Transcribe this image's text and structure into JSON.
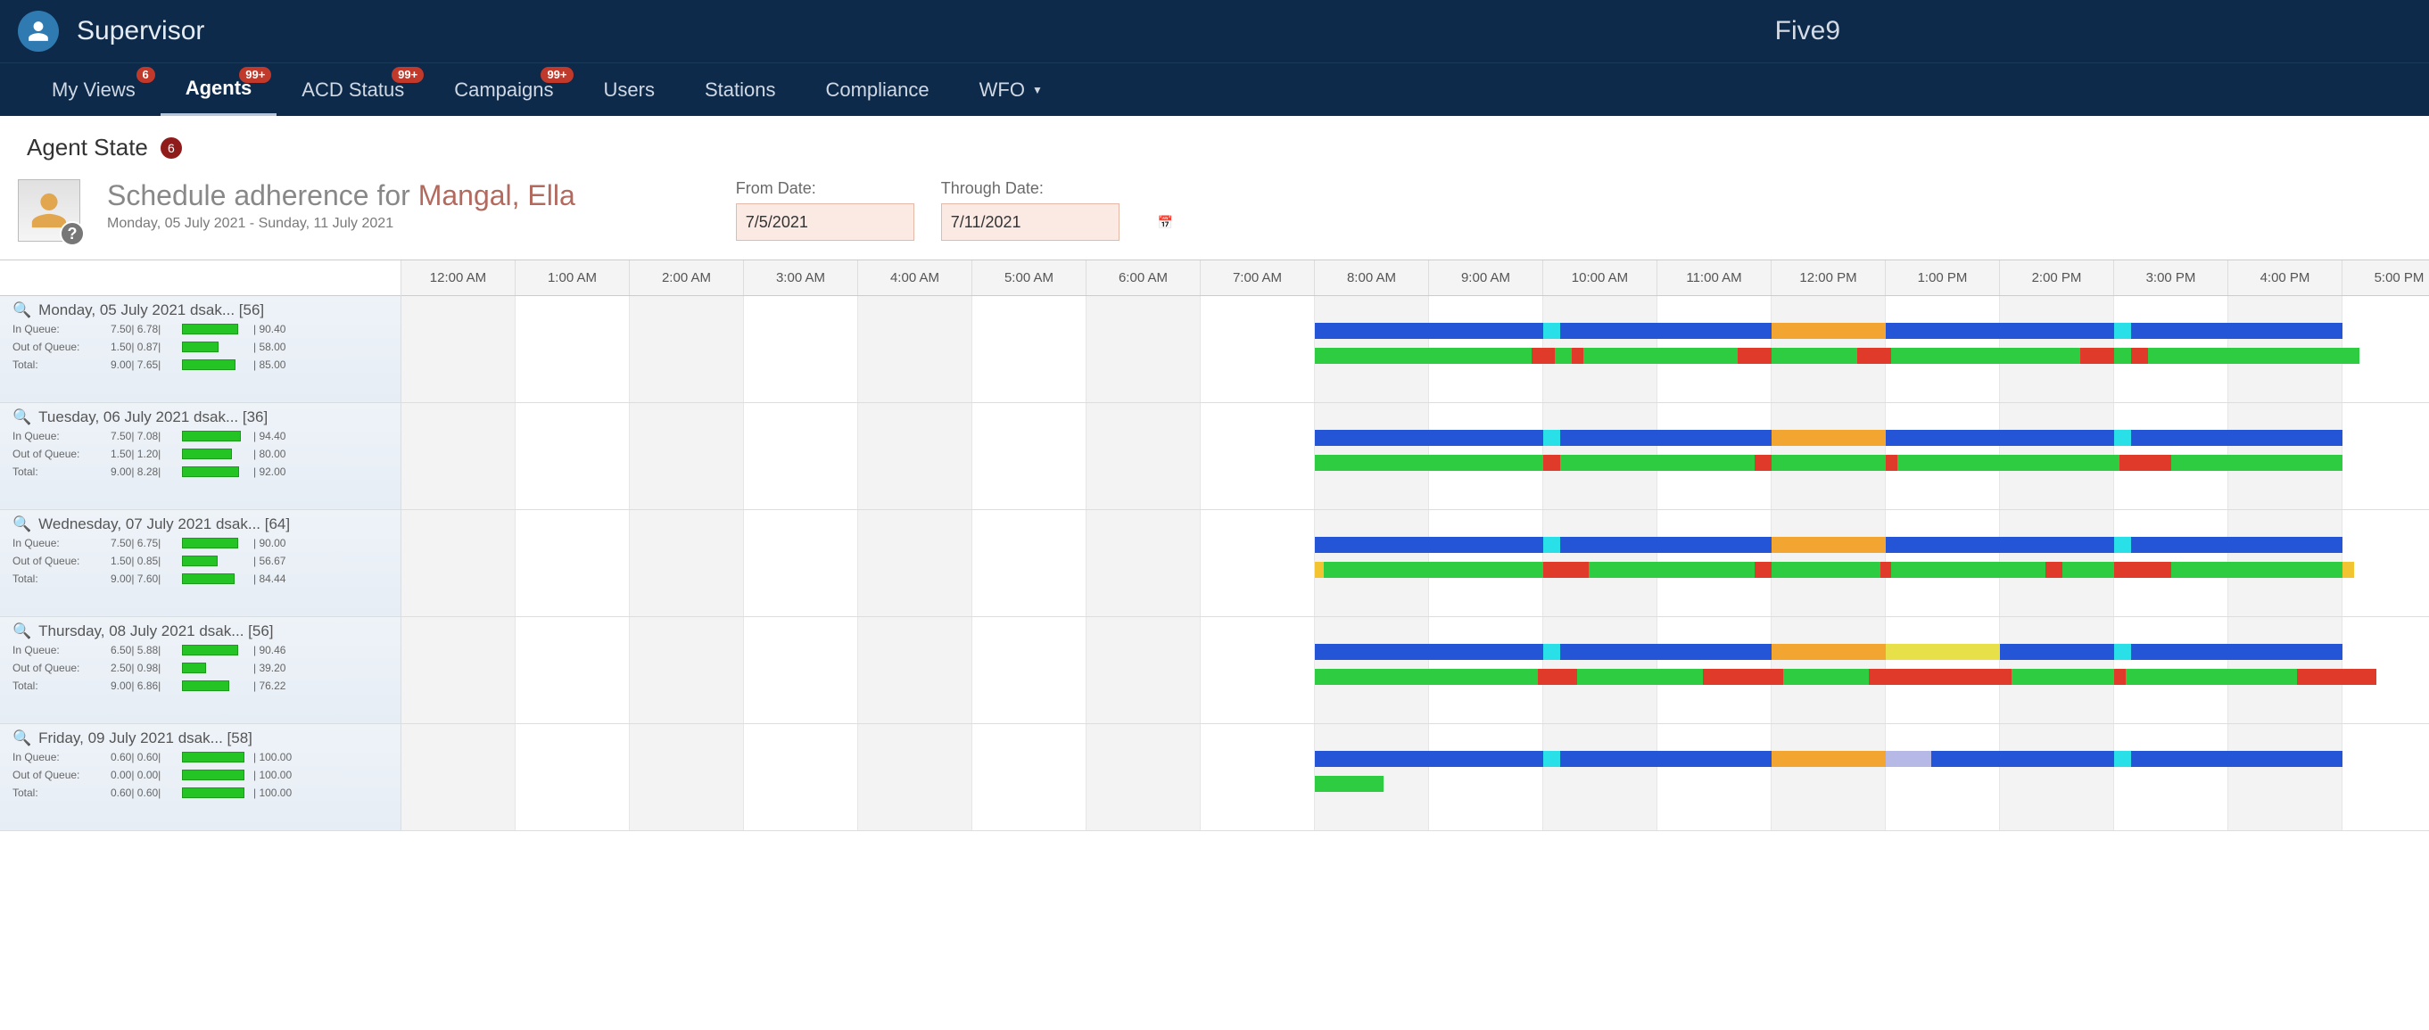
{
  "colors": {
    "blue": "#2455d6",
    "cyan": "#29e0e8",
    "orange": "#f2a531",
    "green": "#2ecc40",
    "red": "#e03a2a",
    "yellow": "#e8e049",
    "lavender": "#b6b9e6",
    "amber": "#f2c431"
  },
  "header": {
    "appTitle": "Supervisor",
    "brand": "Five9"
  },
  "nav": {
    "items": [
      {
        "label": "My Views",
        "badge": "6"
      },
      {
        "label": "Agents",
        "badge": "99+",
        "active": true
      },
      {
        "label": "ACD Status",
        "badge": "99+"
      },
      {
        "label": "Campaigns",
        "badge": "99+"
      },
      {
        "label": "Users"
      },
      {
        "label": "Stations"
      },
      {
        "label": "Compliance"
      },
      {
        "label": "WFO",
        "caret": true
      }
    ]
  },
  "pageHeader": {
    "title": "Agent State",
    "badge": "6"
  },
  "detail": {
    "prefix": "Schedule adherence for ",
    "name": "Mangal, Ella",
    "rangeText": "Monday, 05 July 2021 - Sunday, 11 July 2021",
    "fromLabel": "From Date:",
    "fromValue": "7/5/2021",
    "throughLabel": "Through Date:",
    "throughValue": "7/11/2021"
  },
  "timeHeaders": [
    "12:00 AM",
    "1:00 AM",
    "2:00 AM",
    "3:00 AM",
    "4:00 AM",
    "5:00 AM",
    "6:00 AM",
    "7:00 AM",
    "8:00 AM",
    "9:00 AM",
    "10:00 AM",
    "11:00 AM",
    "12:00 PM",
    "1:00 PM",
    "2:00 PM",
    "3:00 PM",
    "4:00 PM",
    "5:00 PM"
  ],
  "hourPx": 128,
  "statCols": [
    "In Queue:",
    "Out of Queue:",
    "Total:"
  ],
  "days": [
    {
      "title": "Monday, 05 July 2021 dsak...  [56]",
      "stats": [
        {
          "label": "In Queue:",
          "a": "7.50",
          "b": "6.78",
          "barPct": 90,
          "c": "90.40"
        },
        {
          "label": "Out of Queue:",
          "a": "1.50",
          "b": "0.87",
          "barPct": 58,
          "c": "58.00"
        },
        {
          "label": "Total:",
          "a": "9.00",
          "b": "7.65",
          "barPct": 85,
          "c": "85.00"
        }
      ],
      "sched": [
        {
          "start": 8.0,
          "end": 10.0,
          "c": "blue"
        },
        {
          "start": 10.0,
          "end": 10.15,
          "c": "cyan"
        },
        {
          "start": 10.15,
          "end": 12.0,
          "c": "blue"
        },
        {
          "start": 12.0,
          "end": 13.0,
          "c": "orange"
        },
        {
          "start": 13.0,
          "end": 15.0,
          "c": "blue"
        },
        {
          "start": 15.0,
          "end": 15.15,
          "c": "cyan"
        },
        {
          "start": 15.15,
          "end": 17.0,
          "c": "blue"
        }
      ],
      "actual": [
        {
          "start": 8.0,
          "end": 9.9,
          "c": "green"
        },
        {
          "start": 9.9,
          "end": 10.1,
          "c": "red"
        },
        {
          "start": 10.1,
          "end": 10.25,
          "c": "green"
        },
        {
          "start": 10.25,
          "end": 10.35,
          "c": "red"
        },
        {
          "start": 10.35,
          "end": 11.7,
          "c": "green"
        },
        {
          "start": 11.7,
          "end": 12.0,
          "c": "red"
        },
        {
          "start": 12.0,
          "end": 12.75,
          "c": "green"
        },
        {
          "start": 12.75,
          "end": 13.05,
          "c": "red"
        },
        {
          "start": 13.05,
          "end": 14.7,
          "c": "green"
        },
        {
          "start": 14.7,
          "end": 15.0,
          "c": "red"
        },
        {
          "start": 15.0,
          "end": 15.15,
          "c": "green"
        },
        {
          "start": 15.15,
          "end": 15.3,
          "c": "red"
        },
        {
          "start": 15.3,
          "end": 17.15,
          "c": "green"
        }
      ]
    },
    {
      "title": "Tuesday, 06 July 2021 dsak...  [36]",
      "stats": [
        {
          "label": "In Queue:",
          "a": "7.50",
          "b": "7.08",
          "barPct": 94,
          "c": "94.40"
        },
        {
          "label": "Out of Queue:",
          "a": "1.50",
          "b": "1.20",
          "barPct": 80,
          "c": "80.00"
        },
        {
          "label": "Total:",
          "a": "9.00",
          "b": "8.28",
          "barPct": 92,
          "c": "92.00"
        }
      ],
      "sched": [
        {
          "start": 8.0,
          "end": 10.0,
          "c": "blue"
        },
        {
          "start": 10.0,
          "end": 10.15,
          "c": "cyan"
        },
        {
          "start": 10.15,
          "end": 12.0,
          "c": "blue"
        },
        {
          "start": 12.0,
          "end": 13.0,
          "c": "orange"
        },
        {
          "start": 13.0,
          "end": 15.0,
          "c": "blue"
        },
        {
          "start": 15.0,
          "end": 15.15,
          "c": "cyan"
        },
        {
          "start": 15.15,
          "end": 17.0,
          "c": "blue"
        }
      ],
      "actual": [
        {
          "start": 8.0,
          "end": 10.0,
          "c": "green"
        },
        {
          "start": 10.0,
          "end": 10.15,
          "c": "red"
        },
        {
          "start": 10.15,
          "end": 11.85,
          "c": "green"
        },
        {
          "start": 11.85,
          "end": 12.0,
          "c": "red"
        },
        {
          "start": 12.0,
          "end": 13.0,
          "c": "green"
        },
        {
          "start": 13.0,
          "end": 13.1,
          "c": "red"
        },
        {
          "start": 13.1,
          "end": 15.05,
          "c": "green"
        },
        {
          "start": 15.05,
          "end": 15.5,
          "c": "red"
        },
        {
          "start": 15.5,
          "end": 17.0,
          "c": "green"
        }
      ]
    },
    {
      "title": "Wednesday, 07 July 2021 dsak...  [64]",
      "stats": [
        {
          "label": "In Queue:",
          "a": "7.50",
          "b": "6.75",
          "barPct": 90,
          "c": "90.00"
        },
        {
          "label": "Out of Queue:",
          "a": "1.50",
          "b": "0.85",
          "barPct": 57,
          "c": "56.67"
        },
        {
          "label": "Total:",
          "a": "9.00",
          "b": "7.60",
          "barPct": 84,
          "c": "84.44"
        }
      ],
      "sched": [
        {
          "start": 8.0,
          "end": 10.0,
          "c": "blue"
        },
        {
          "start": 10.0,
          "end": 10.15,
          "c": "cyan"
        },
        {
          "start": 10.15,
          "end": 12.0,
          "c": "blue"
        },
        {
          "start": 12.0,
          "end": 13.0,
          "c": "orange"
        },
        {
          "start": 13.0,
          "end": 15.0,
          "c": "blue"
        },
        {
          "start": 15.0,
          "end": 15.15,
          "c": "cyan"
        },
        {
          "start": 15.15,
          "end": 17.0,
          "c": "blue"
        }
      ],
      "actual": [
        {
          "start": 8.0,
          "end": 8.08,
          "c": "amber"
        },
        {
          "start": 8.08,
          "end": 10.0,
          "c": "green"
        },
        {
          "start": 10.0,
          "end": 10.4,
          "c": "red"
        },
        {
          "start": 10.4,
          "end": 11.85,
          "c": "green"
        },
        {
          "start": 11.85,
          "end": 12.0,
          "c": "red"
        },
        {
          "start": 12.0,
          "end": 12.95,
          "c": "green"
        },
        {
          "start": 12.95,
          "end": 13.05,
          "c": "red"
        },
        {
          "start": 13.05,
          "end": 14.4,
          "c": "green"
        },
        {
          "start": 14.4,
          "end": 14.55,
          "c": "red"
        },
        {
          "start": 14.55,
          "end": 15.0,
          "c": "green"
        },
        {
          "start": 15.0,
          "end": 15.5,
          "c": "red"
        },
        {
          "start": 15.5,
          "end": 17.0,
          "c": "green"
        },
        {
          "start": 17.0,
          "end": 17.1,
          "c": "amber"
        }
      ]
    },
    {
      "title": "Thursday, 08 July 2021 dsak...  [56]",
      "stats": [
        {
          "label": "In Queue:",
          "a": "6.50",
          "b": "5.88",
          "barPct": 90,
          "c": "90.46"
        },
        {
          "label": "Out of Queue:",
          "a": "2.50",
          "b": "0.98",
          "barPct": 39,
          "c": "39.20"
        },
        {
          "label": "Total:",
          "a": "9.00",
          "b": "6.86",
          "barPct": 76,
          "c": "76.22"
        }
      ],
      "sched": [
        {
          "start": 8.0,
          "end": 10.0,
          "c": "blue"
        },
        {
          "start": 10.0,
          "end": 10.15,
          "c": "cyan"
        },
        {
          "start": 10.15,
          "end": 12.0,
          "c": "blue"
        },
        {
          "start": 12.0,
          "end": 13.0,
          "c": "orange"
        },
        {
          "start": 13.0,
          "end": 14.0,
          "c": "yellow"
        },
        {
          "start": 14.0,
          "end": 15.0,
          "c": "blue"
        },
        {
          "start": 15.0,
          "end": 15.15,
          "c": "cyan"
        },
        {
          "start": 15.15,
          "end": 17.0,
          "c": "blue"
        }
      ],
      "actual": [
        {
          "start": 8.0,
          "end": 9.95,
          "c": "green"
        },
        {
          "start": 9.95,
          "end": 10.3,
          "c": "red"
        },
        {
          "start": 10.3,
          "end": 11.4,
          "c": "green"
        },
        {
          "start": 11.4,
          "end": 12.1,
          "c": "red"
        },
        {
          "start": 12.1,
          "end": 12.85,
          "c": "green"
        },
        {
          "start": 12.85,
          "end": 14.1,
          "c": "red"
        },
        {
          "start": 14.1,
          "end": 15.0,
          "c": "green"
        },
        {
          "start": 15.0,
          "end": 15.1,
          "c": "red"
        },
        {
          "start": 15.1,
          "end": 16.6,
          "c": "green"
        },
        {
          "start": 16.6,
          "end": 17.3,
          "c": "red"
        }
      ]
    },
    {
      "title": "Friday, 09 July 2021  dsak...  [58]",
      "stats": [
        {
          "label": "In Queue:",
          "a": "0.60",
          "b": "0.60",
          "barPct": 100,
          "c": "100.00"
        },
        {
          "label": "Out of Queue:",
          "a": "0.00",
          "b": "0.00",
          "barPct": 100,
          "c": "100.00"
        },
        {
          "label": "Total:",
          "a": "0.60",
          "b": "0.60",
          "barPct": 100,
          "c": "100.00"
        }
      ],
      "sched": [
        {
          "start": 8.0,
          "end": 10.0,
          "c": "blue"
        },
        {
          "start": 10.0,
          "end": 10.15,
          "c": "cyan"
        },
        {
          "start": 10.15,
          "end": 12.0,
          "c": "blue"
        },
        {
          "start": 12.0,
          "end": 13.0,
          "c": "orange"
        },
        {
          "start": 13.0,
          "end": 13.4,
          "c": "lavender"
        },
        {
          "start": 13.4,
          "end": 15.0,
          "c": "blue"
        },
        {
          "start": 15.0,
          "end": 15.15,
          "c": "cyan"
        },
        {
          "start": 15.15,
          "end": 17.0,
          "c": "blue"
        }
      ],
      "actual": [
        {
          "start": 8.0,
          "end": 8.6,
          "c": "green"
        }
      ]
    }
  ]
}
